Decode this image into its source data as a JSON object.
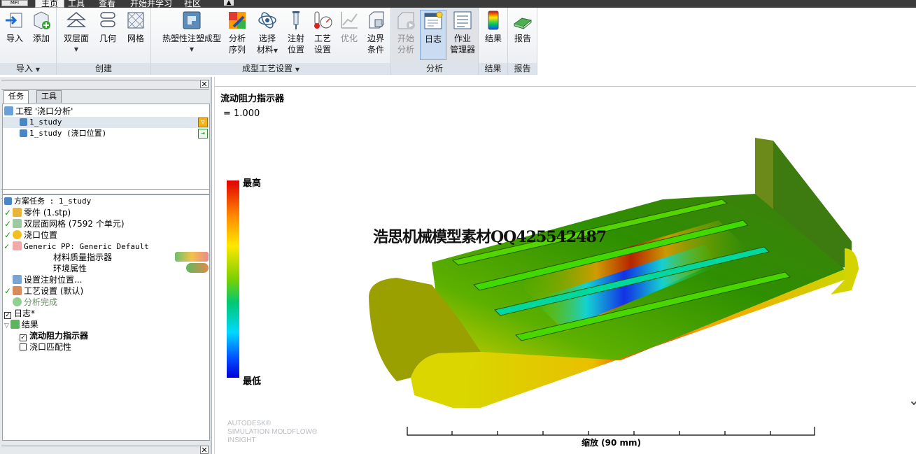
{
  "ribbon": {
    "app_button": "MFI",
    "tabs": [
      "主页",
      "工具",
      "查看",
      "开始并学习",
      "社区"
    ],
    "groups": {
      "import": "导入",
      "create": "创建",
      "process": "成型工艺设置",
      "analysis": "分析",
      "results": "结果",
      "report": "报告"
    },
    "buttons": {
      "import": "导入",
      "add": "添加",
      "dual_domain": "双层面",
      "geometry": "几何",
      "mesh": "网格",
      "process_type": "热塑性注塑成型",
      "analysis_seq_1": "分析",
      "analysis_seq_2": "序列",
      "select_mat_1": "选择",
      "select_mat_2": "材料",
      "inj_loc_1": "注射",
      "inj_loc_2": "位置",
      "proc_set_1": "工艺",
      "proc_set_2": "设置",
      "optimize": "优化",
      "boundary_1": "边界",
      "boundary_2": "条件",
      "start_1": "开始",
      "start_2": "分析",
      "log": "日志",
      "job_1": "作业",
      "job_2": "管理器",
      "results": "结果",
      "report": "报告"
    }
  },
  "left_panel": {
    "tabs": [
      "任务",
      "工具"
    ],
    "project": {
      "title": "工程 '浇口分析'",
      "studies": [
        "1_study",
        "1_study (浇口位置)"
      ]
    },
    "tasks": {
      "header": "方案任务 : 1_study",
      "part": "零件 (1.stp)",
      "mesh": "双层面网格 (7592 个单元)",
      "gate": "浇口位置",
      "material": "Generic PP: Generic Default",
      "mat_quality": "材料质量指示器",
      "env": "环境属性",
      "inj_loc": "设置注射位置...",
      "process": "工艺设置 (默认)",
      "analysis_done": "分析完成",
      "log": "日志*",
      "results": "结果",
      "result_flow": "流动阻力指示器",
      "result_gate": "浇口匹配性"
    }
  },
  "viewport": {
    "result_title": "流动阻力指示器",
    "result_value": "= 1.000",
    "legend_high": "最高",
    "legend_low": "最低",
    "watermark": "浩思机械模型素材QQ425542487",
    "brand_lines": [
      "AUTODESK®",
      "SIMULATION MOLDFLOW®",
      "INSIGHT"
    ],
    "scale_label": "缩放 (90 mm)"
  },
  "colors": {
    "scale_high": "#e00000",
    "scale_mid": "#7bd000",
    "scale_low": "#0000d8"
  }
}
